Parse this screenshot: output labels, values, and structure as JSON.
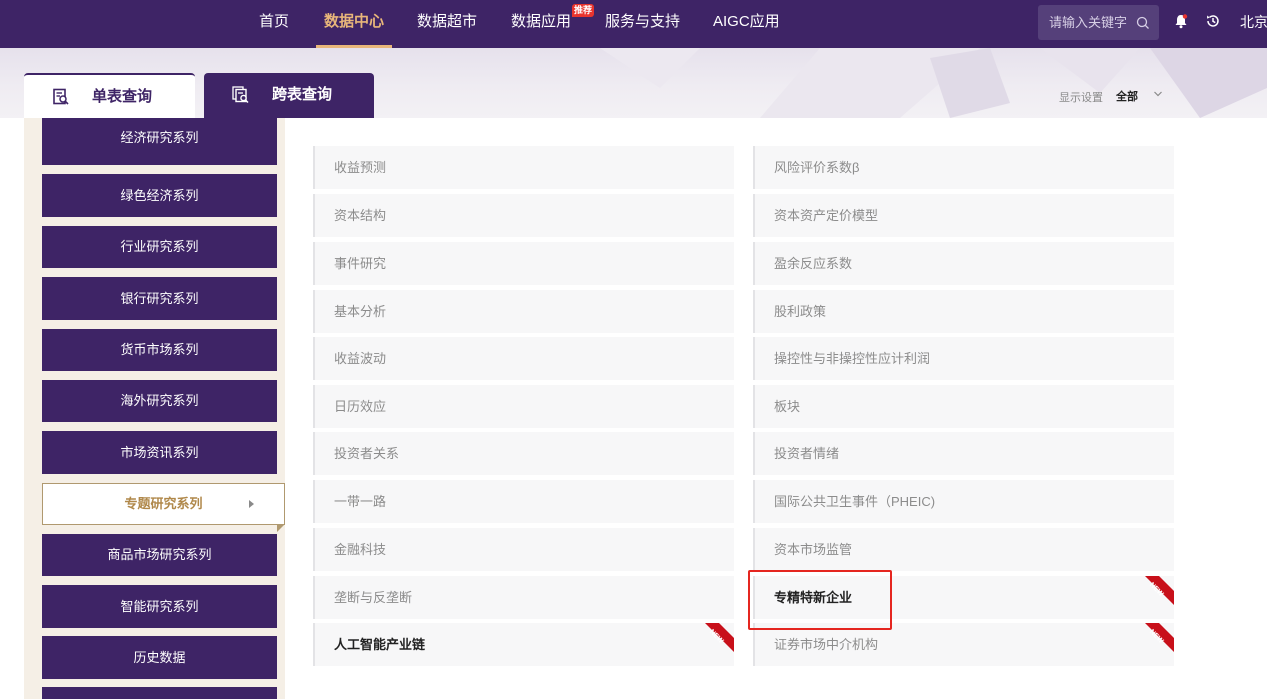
{
  "nav": {
    "items": [
      "首页",
      "数据中心",
      "数据超市",
      "数据应用",
      "服务与支持",
      "AIGC应用"
    ],
    "active_index": 1,
    "badge": "推荐",
    "search_placeholder": "请输入关键字",
    "city": "北京"
  },
  "tabs": [
    {
      "label": "单表查询",
      "active": true
    },
    {
      "label": "跨表查询",
      "active": false
    }
  ],
  "display": {
    "label": "显示设置",
    "value": "全部"
  },
  "sidebar": {
    "items": [
      "经济研究系列",
      "绿色经济系列",
      "行业研究系列",
      "银行研究系列",
      "货币市场系列",
      "海外研究系列",
      "市场资讯系列",
      "专题研究系列",
      "商品市场研究系列",
      "智能研究系列",
      "历史数据"
    ],
    "active_index": 7
  },
  "grid": {
    "left": [
      "收益预测",
      "资本结构",
      "事件研究",
      "基本分析",
      "收益波动",
      "日历效应",
      "投资者关系",
      "一带一路",
      "金融科技",
      "垄断与反垄断",
      "人工智能产业链"
    ],
    "right": [
      "风险评价系数β",
      "资本资产定价模型",
      "盈余反应系数",
      "股利政策",
      "操控性与非操控性应计利润",
      "板块",
      "投资者情绪",
      "国际公共卫生事件（PHEIC)",
      "资本市场监管",
      "专精特新企业",
      "证券市场中介机构"
    ],
    "new_label": "NEW",
    "new_flags": {
      "left": [
        10
      ],
      "right": [
        9,
        10
      ]
    },
    "bold": {
      "left": [
        10
      ],
      "right": [
        9
      ]
    }
  },
  "colors": {
    "brand": "#3e2466",
    "accent": "#e8b67a",
    "highlight": "#e52620",
    "new_ribbon": "#c8101a"
  }
}
